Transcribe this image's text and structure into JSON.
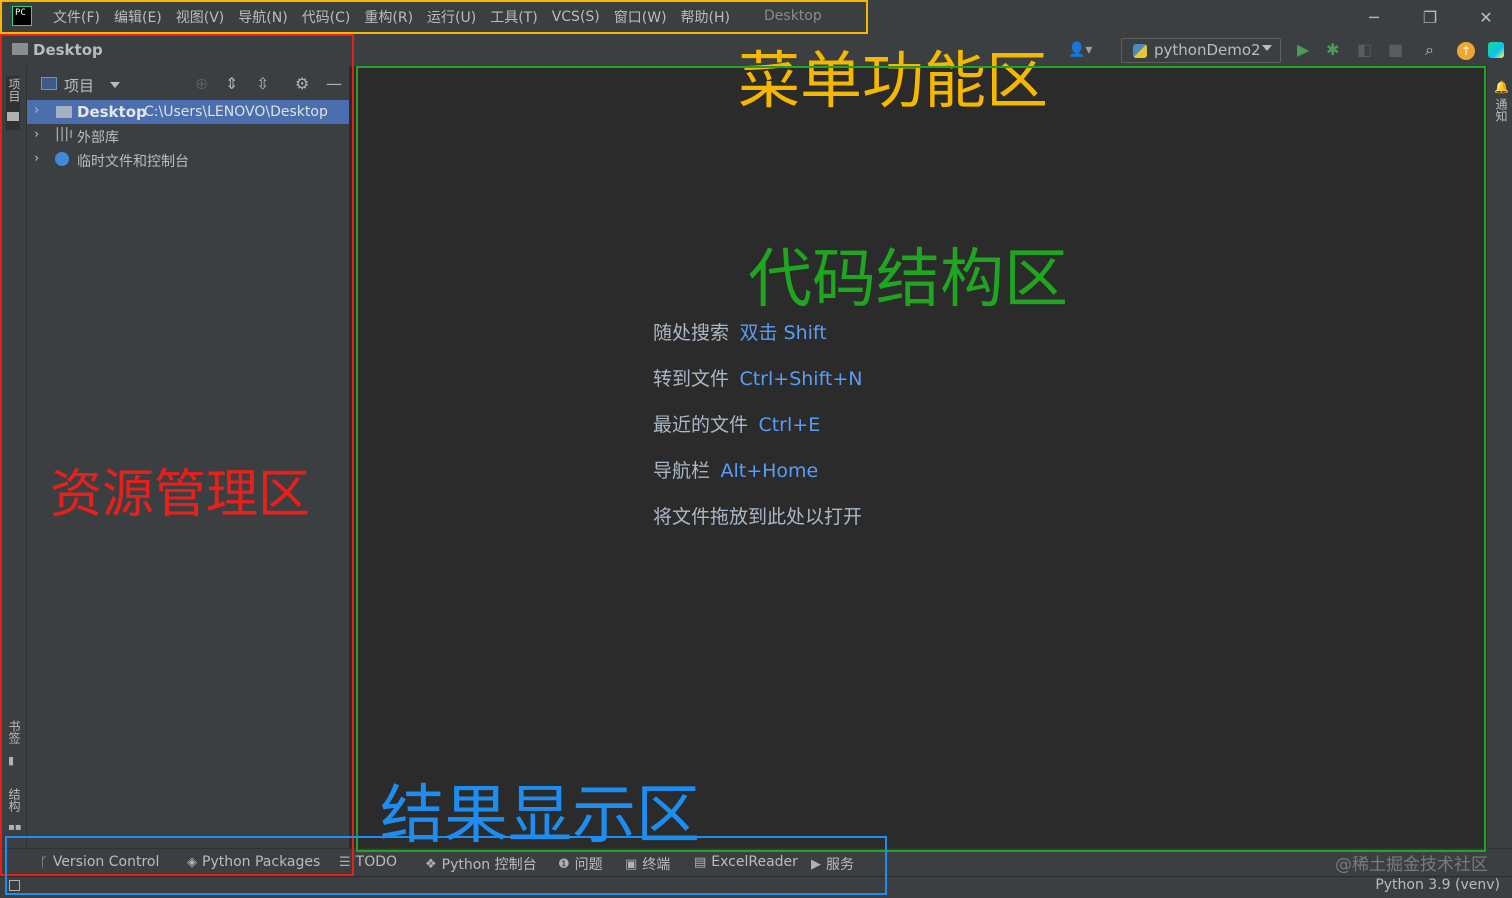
{
  "window": {
    "title": "Desktop",
    "controls": [
      "─",
      "❐",
      "✕"
    ]
  },
  "menu": {
    "items": [
      "文件(F)",
      "编辑(E)",
      "视图(V)",
      "导航(N)",
      "代码(C)",
      "重构(R)",
      "运行(U)",
      "工具(T)",
      "VCS(S)",
      "窗口(W)",
      "帮助(H)"
    ]
  },
  "navbar": {
    "project_name": "Desktop",
    "run_config": "pythonDemo2"
  },
  "left_strip": {
    "project_tab": "项目",
    "bookmarks_tab": "书签",
    "structure_tab": "结构"
  },
  "right_strip": {
    "notifications_tab": "通知"
  },
  "project_panel": {
    "header_label": "项目",
    "tree": [
      {
        "name": "Desktop",
        "path": "C:\\Users\\LENOVO\\Desktop",
        "selected": true
      },
      {
        "name": "外部库",
        "path": ""
      },
      {
        "name": "临时文件和控制台",
        "path": ""
      }
    ]
  },
  "editor_hints": [
    {
      "label": "随处搜索",
      "key": "双击 Shift"
    },
    {
      "label": "转到文件",
      "key": "Ctrl+Shift+N"
    },
    {
      "label": "最近的文件",
      "key": "Ctrl+E"
    },
    {
      "label": "导航栏",
      "key": "Alt+Home"
    },
    {
      "label": "将文件拖放到此处以打开",
      "key": ""
    }
  ],
  "bottom_tools": [
    {
      "label": "Version Control",
      "icon": "branch-icon"
    },
    {
      "label": "Python Packages",
      "icon": "layers-icon"
    },
    {
      "label": "TODO",
      "icon": "list-icon"
    },
    {
      "label": "Python 控制台",
      "icon": "python-icon"
    },
    {
      "label": "问题",
      "icon": "info-icon"
    },
    {
      "label": "终端",
      "icon": "terminal-icon"
    },
    {
      "label": "ExcelReader",
      "icon": "excel-icon"
    },
    {
      "label": "服务",
      "icon": "play-icon"
    }
  ],
  "status": {
    "interpreter": "Python 3.9 (venv)",
    "watermark": "@稀土掘金技术社区"
  },
  "annotations": {
    "menu_zone": {
      "label": "菜单功能区",
      "color": "#f5b800"
    },
    "project_zone": {
      "label": "资源管理区",
      "color": "#e8201c"
    },
    "code_zone": {
      "label": "代码结构区",
      "color": "#1fa51f"
    },
    "result_zone": {
      "label": "结果显示区",
      "color": "#1d8ef0"
    }
  }
}
